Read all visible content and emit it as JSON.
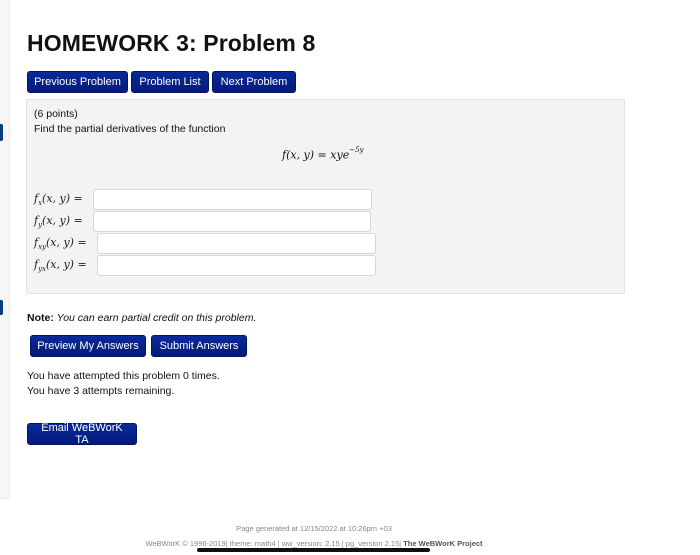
{
  "page_title": "HOMEWORK 3: Problem 8",
  "nav": {
    "previous": "Previous Problem",
    "list": "Problem List",
    "next": "Next Problem"
  },
  "problem": {
    "points": "(6 points)",
    "instruction": "Find the partial derivatives of the function",
    "function": {
      "lhs": "f(x, y) = xye",
      "exponent": "−5y"
    },
    "answers": [
      {
        "name": "f",
        "sub": "x",
        "args": "(x, y) =",
        "value": ""
      },
      {
        "name": "f",
        "sub": "y",
        "args": "(x, y) =",
        "value": ""
      },
      {
        "name": "f",
        "sub": "xy",
        "args": "(x, y) =",
        "value": ""
      },
      {
        "name": "f",
        "sub": "yx",
        "args": "(x, y) =",
        "value": ""
      }
    ]
  },
  "note": {
    "label": "Note:",
    "text": "You can earn partial credit on this problem."
  },
  "actions": {
    "preview": "Preview My Answers",
    "submit": "Submit Answers"
  },
  "status": {
    "attempted": "You have attempted this problem 0 times.",
    "remaining": "You have 3 attempts remaining."
  },
  "email_button": "Email WeBWorK TA",
  "footer": {
    "generated": "Page generated at 12/15/2022 at 10:26pm +03",
    "version": "WeBWorK © 1996-2019| theme: math4 | ww_version: 2.15 | pg_version 2.15|",
    "project": "The WeBWorK Project"
  }
}
